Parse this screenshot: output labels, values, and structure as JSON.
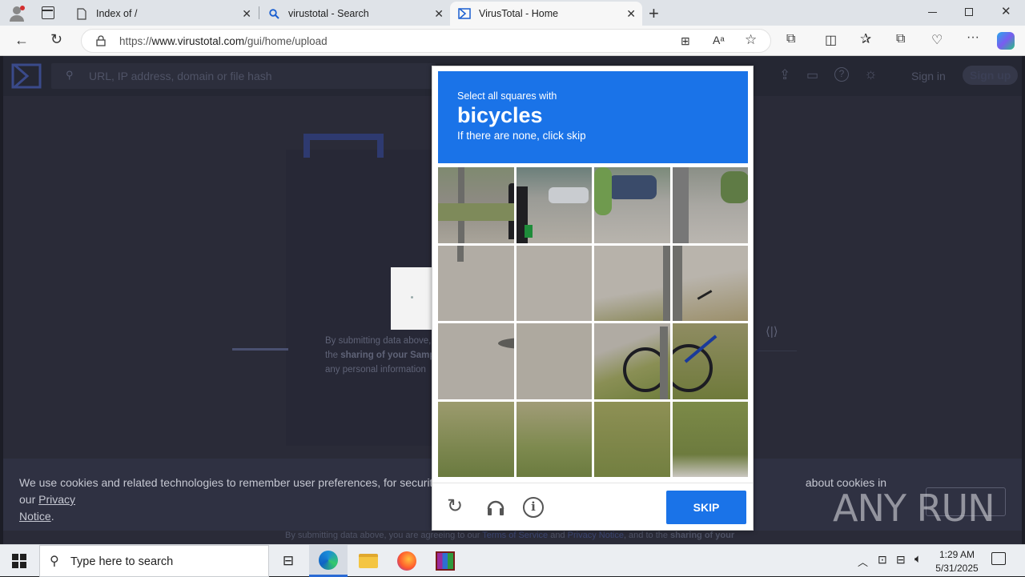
{
  "browser": {
    "tabs": [
      {
        "title": "Index of /"
      },
      {
        "title": "virustotal - Search"
      },
      {
        "title": "VirusTotal - Home"
      }
    ],
    "url_prefix": "https://",
    "url_domain": "www.virustotal.com",
    "url_path": "/gui/home/upload"
  },
  "vt": {
    "search_placeholder": "URL, IP address, domain or file hash",
    "signin": "Sign in",
    "signup": "Sign up",
    "submit_text_1": "By submitting data above,",
    "submit_text_2": "the",
    "submit_text_2b": "sharing of your Sampl",
    "submit_text_3": "any personal information",
    "bottom_text_a": "By submitting data above, you are agreeing to our",
    "bottom_terms": "Terms of Service",
    "bottom_and": "and",
    "bottom_privacy": "Privacy Notice",
    "bottom_text_b": ", and to the",
    "bottom_sharing": "sharing of your"
  },
  "cookie": {
    "text_a": "We use cookies and related technologies to remember user preferences, for security, to",
    "text_b": "about cookies in our",
    "link": "Privacy",
    "link2": "Notice",
    "period": "."
  },
  "captcha": {
    "line1": "Select all squares with",
    "keyword": "bicycles",
    "line3": "If there are none, click skip",
    "skip": "SKIP"
  },
  "watermark": "ANY RUN",
  "taskbar": {
    "search_placeholder": "Type here to search",
    "time": "1:29 AM",
    "date": "5/31/2025"
  },
  "colors": {
    "captcha_blue": "#1a73e8",
    "vt_bg": "#252733"
  }
}
